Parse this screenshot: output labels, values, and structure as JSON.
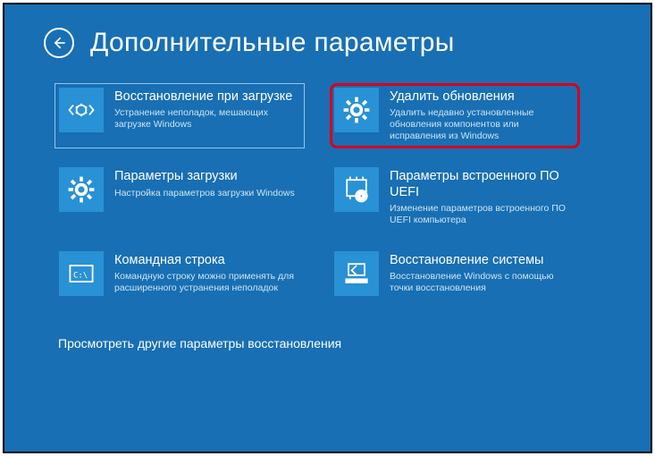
{
  "header": {
    "title": "Дополнительные параметры"
  },
  "tiles": {
    "startup_repair": {
      "title": "Восстановление при загрузке",
      "desc": "Устранение неполадок, мешающих загрузке Windows"
    },
    "uninstall_updates": {
      "title": "Удалить обновления",
      "desc": "Удалить недавно установленные обновления компонентов или исправления из Windows"
    },
    "startup_settings": {
      "title": "Параметры загрузки",
      "desc": "Настройка параметров загрузки Windows"
    },
    "uefi": {
      "title": "Параметры встроенного ПО UEFI",
      "desc": "Изменение параметров встроенного ПО UEFI компьютера"
    },
    "cmd": {
      "title": "Командная строка",
      "desc": "Командную строку можно применять для расширенного устранения неполадок"
    },
    "system_restore": {
      "title": "Восстановление системы",
      "desc": "Восстановление Windows с помощью точки восстановления"
    }
  },
  "more": "Просмотреть другие параметры восстановления"
}
